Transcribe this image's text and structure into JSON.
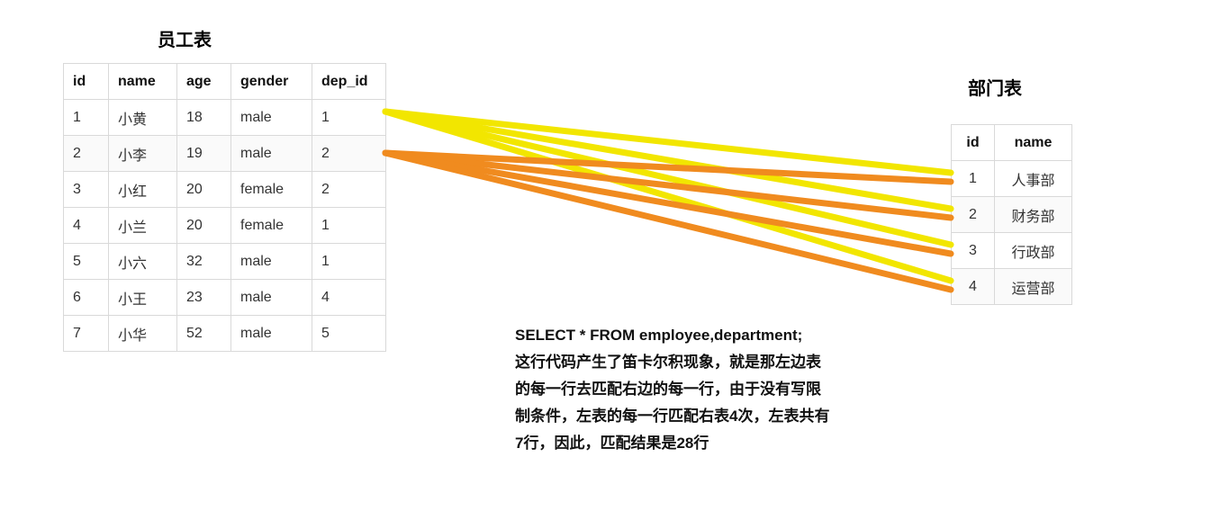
{
  "employee": {
    "title": "员工表",
    "headers": {
      "id": "id",
      "name": "name",
      "age": "age",
      "gender": "gender",
      "dep_id": "dep_id"
    },
    "rows": [
      {
        "id": "1",
        "name": "小黄",
        "age": "18",
        "gender": "male",
        "dep_id": "1"
      },
      {
        "id": "2",
        "name": "小李",
        "age": "19",
        "gender": "male",
        "dep_id": "2"
      },
      {
        "id": "3",
        "name": "小红",
        "age": "20",
        "gender": "female",
        "dep_id": "2"
      },
      {
        "id": "4",
        "name": "小兰",
        "age": "20",
        "gender": "female",
        "dep_id": "1"
      },
      {
        "id": "5",
        "name": "小六",
        "age": "32",
        "gender": "male",
        "dep_id": "1"
      },
      {
        "id": "6",
        "name": "小王",
        "age": "23",
        "gender": "male",
        "dep_id": "4"
      },
      {
        "id": "7",
        "name": "小华",
        "age": "52",
        "gender": "male",
        "dep_id": "5"
      }
    ]
  },
  "department": {
    "title": "部门表",
    "headers": {
      "id": "id",
      "name": "name"
    },
    "rows": [
      {
        "id": "1",
        "name": "人事部"
      },
      {
        "id": "2",
        "name": "财务部"
      },
      {
        "id": "3",
        "name": "行政部"
      },
      {
        "id": "4",
        "name": "运营部"
      }
    ]
  },
  "caption": {
    "line1": "SELECT * FROM employee,department;",
    "line2": "这行代码产生了笛卡尔积现象，就是那左边表",
    "line3": "的每一行去匹配右边的每一行，由于没有写限",
    "line4": "制条件，左表的每一行匹配右表4次，左表共有",
    "line5": "7行，因此，匹配结果是28行"
  },
  "colors": {
    "yellow": "#f2e600",
    "orange": "#f08b1f"
  },
  "connections": {
    "yellow_from_emp_row": 0,
    "orange_from_emp_row": 1,
    "to_dep_rows": [
      0,
      1,
      2,
      3
    ]
  }
}
